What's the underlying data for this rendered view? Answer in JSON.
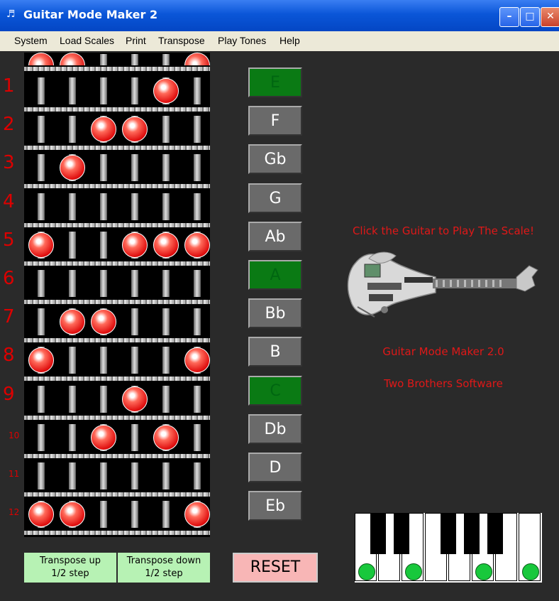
{
  "window": {
    "title": "Guitar Mode Maker 2",
    "icon": "guitar-app-icon",
    "buttons": [
      "minimize",
      "maximize",
      "close"
    ]
  },
  "menu": [
    "System",
    "Load Scales",
    "Print",
    "Transpose",
    "Play Tones",
    "Help"
  ],
  "fretboard": {
    "frets": [
      "1",
      "2",
      "3",
      "4",
      "5",
      "6",
      "7",
      "8",
      "9",
      "10",
      "11",
      "12"
    ],
    "open_strings_marked": [
      1,
      2,
      6
    ],
    "fret_dots": {
      "1": [
        5
      ],
      "2": [
        3,
        4
      ],
      "3": [
        2
      ],
      "4": [],
      "5": [
        1,
        4,
        5,
        6
      ],
      "6": [],
      "7": [
        2,
        3
      ],
      "8": [
        1,
        6
      ],
      "9": [
        4
      ],
      "10": [
        3,
        5
      ],
      "11": [],
      "12": [
        1,
        2,
        6
      ]
    },
    "dot_color": "#e01010"
  },
  "notes": [
    {
      "label": "E",
      "active": true
    },
    {
      "label": "F",
      "active": false
    },
    {
      "label": "Gb",
      "active": false
    },
    {
      "label": "G",
      "active": false
    },
    {
      "label": "Ab",
      "active": false
    },
    {
      "label": "A",
      "active": true
    },
    {
      "label": "Bb",
      "active": false
    },
    {
      "label": "B",
      "active": false
    },
    {
      "label": "C",
      "active": true
    },
    {
      "label": "Db",
      "active": false
    },
    {
      "label": "D",
      "active": false
    },
    {
      "label": "Eb",
      "active": false
    }
  ],
  "info": {
    "click_hint": "Click the Guitar to Play The Scale!",
    "app_name": "Guitar Mode Maker 2.0",
    "company": "Two Brothers Software"
  },
  "transpose": {
    "up": {
      "line1": "Transpose up",
      "line2": "1/2 step"
    },
    "down": {
      "line1": "Transpose down",
      "line2": "1/2 step"
    }
  },
  "reset_label": "RESET",
  "piano": {
    "white_keys": 8,
    "marked_white_keys": [
      1,
      3,
      6,
      8
    ],
    "dot_color": "#18c83c"
  },
  "colors": {
    "background": "#2a2a2a",
    "active_note": "#0a7a14",
    "inactive_note": "#6a6a6a",
    "accent_red": "#e01818",
    "transpose_bg": "#b7f2b4",
    "reset_bg": "#f8b6b6"
  }
}
